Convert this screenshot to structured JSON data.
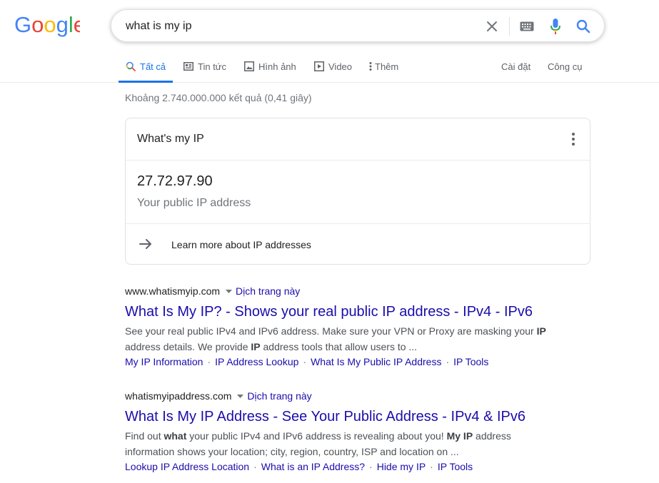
{
  "search": {
    "query": "what is my ip"
  },
  "tabs": [
    {
      "label": "Tất cả",
      "icon": "search-icon",
      "active": true
    },
    {
      "label": "Tin tức",
      "icon": "news-icon",
      "active": false
    },
    {
      "label": "Hình ảnh",
      "icon": "image-icon",
      "active": false
    },
    {
      "label": "Video",
      "icon": "video-icon",
      "active": false
    },
    {
      "label": "Thêm",
      "icon": "more-vert-icon",
      "active": false
    }
  ],
  "tools": {
    "settings_label": "Cài đặt",
    "tools_label": "Công cụ"
  },
  "stats": "Khoảng 2.740.000.000 kết quả (0,41 giây)",
  "ip_card": {
    "title": "What's my IP",
    "ip": "27.72.97.90",
    "caption": "Your public IP address",
    "learn_more": "Learn more about IP addresses"
  },
  "results": [
    {
      "url": "www.whatismyip.com",
      "translate": "Dịch trang này",
      "title": "What Is My IP? - Shows your real public IP address - IPv4 - IPv6",
      "snippet_1": "See your real public IPv4 and IPv6 address. Make sure your VPN or Proxy are masking your ",
      "snippet_1_bold": "IP",
      "snippet_2": "address details. We provide ",
      "snippet_2_bold": "IP",
      "snippet_3": " address tools that allow users to ...",
      "sitelinks": [
        "My IP Information",
        "IP Address Lookup",
        "What Is My Public IP Address",
        "IP Tools"
      ]
    },
    {
      "url": "whatismyipaddress.com",
      "translate": "Dịch trang này",
      "title": "What Is My IP Address - See Your Public Address - IPv4 & IPv6",
      "snippet_1": "Find out ",
      "snippet_1_bold": "what",
      "snippet_2": " your public IPv4 and IPv6 address is revealing about you! ",
      "snippet_2_bold": "My IP",
      "snippet_3": " address",
      "snippet_4": "information shows your location; city, region, country, ISP and location on ...",
      "sitelinks": [
        "Lookup IP Address Location",
        "What is an IP Address?",
        "Hide my IP",
        "IP Tools"
      ]
    }
  ],
  "colors": {
    "google_blue": "#4285F4",
    "google_red": "#EA4335",
    "google_yellow": "#FBBC05",
    "google_green": "#34A853",
    "link": "#1a0dab",
    "accent": "#1a73e8"
  }
}
